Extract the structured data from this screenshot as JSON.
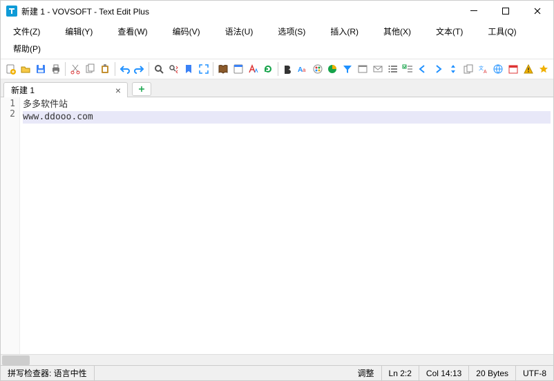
{
  "title": "新建 1 - VOVSOFT - Text Edit Plus",
  "menus": {
    "file": "文件(Z)",
    "edit": "编辑(Y)",
    "view": "查看(W)",
    "encode": "编码(V)",
    "syntax": "语法(U)",
    "option": "选项(S)",
    "insert": "插入(R)",
    "other": "其他(X)",
    "text": "文本(T)",
    "tool": "工具(Q)",
    "help": "帮助(P)"
  },
  "tabs": {
    "active": "新建 1"
  },
  "editor": {
    "lines": [
      "多多软件站",
      "www.ddooo.com"
    ],
    "activeLine": 2
  },
  "status": {
    "spell": "拼写检查器: 语言中性",
    "adjust": "调整",
    "ln": "Ln 2:2",
    "col": "Col 14:13",
    "bytes": "20 Bytes",
    "enc": "UTF-8"
  },
  "icons": {
    "new": "file-new",
    "open": "folder-open",
    "save": "disk",
    "print": "printer",
    "cut": "scissors",
    "copy": "copy",
    "paste": "clipboard",
    "undo": "undo",
    "redo": "redo",
    "find": "search",
    "findreplace": "search-arrows",
    "bookmark": "bookmark",
    "fullscreen": "expand",
    "book": "book",
    "browser": "globe",
    "fonts": "fonts",
    "refresh": "refresh",
    "bold": "bold",
    "case": "case",
    "palette": "palette",
    "pie": "pie",
    "filter": "funnel",
    "window": "window",
    "mail": "mail",
    "list": "list",
    "todo": "checklist",
    "left": "arrow-left",
    "right": "arrow-right",
    "updown": "updown",
    "duplicate": "duplicate",
    "translate": "translate",
    "web": "web",
    "calendar": "calendar",
    "warn": "warning",
    "star": "star"
  }
}
